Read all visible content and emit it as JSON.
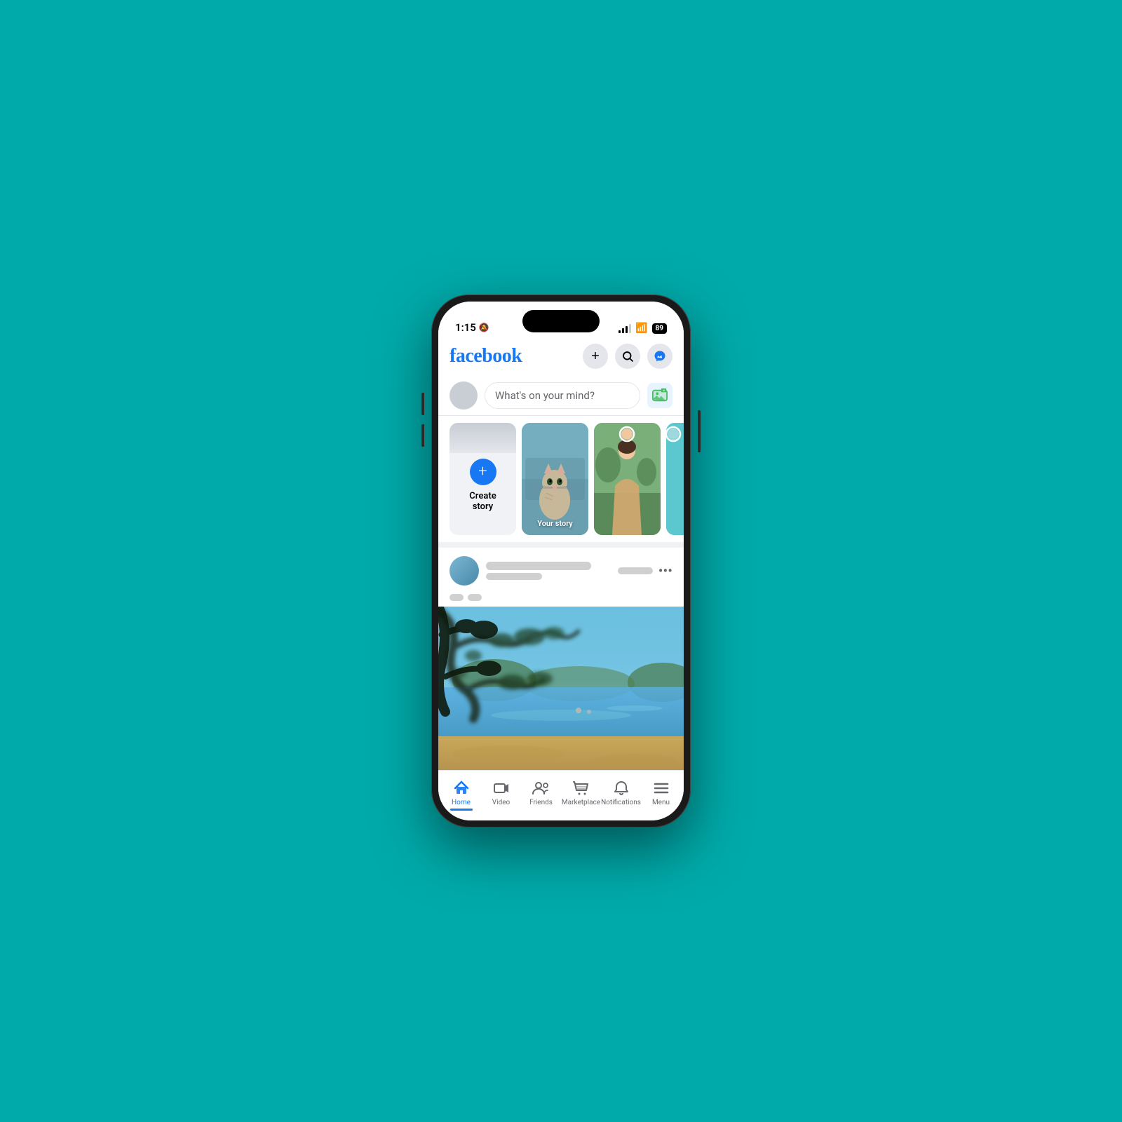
{
  "background_color": "#00AAAA",
  "phone": {
    "status_bar": {
      "time": "1:15",
      "mute_icon": "🔕",
      "battery": "89"
    },
    "header": {
      "logo": "facebook",
      "buttons": {
        "add": "+",
        "search": "🔍",
        "messenger": "⚡"
      }
    },
    "post_input": {
      "placeholder": "What's on your mind?"
    },
    "stories": {
      "create": {
        "label_line1": "Create",
        "label_line2": "story"
      },
      "your_story": {
        "label": "Your story"
      }
    },
    "bottom_nav": {
      "items": [
        {
          "id": "home",
          "label": "Home",
          "active": true
        },
        {
          "id": "video",
          "label": "Video",
          "active": false
        },
        {
          "id": "friends",
          "label": "Friends",
          "active": false
        },
        {
          "id": "marketplace",
          "label": "Marketplace",
          "active": false
        },
        {
          "id": "notifications",
          "label": "Notifications",
          "active": false
        },
        {
          "id": "menu",
          "label": "Menu",
          "active": false
        }
      ]
    }
  }
}
